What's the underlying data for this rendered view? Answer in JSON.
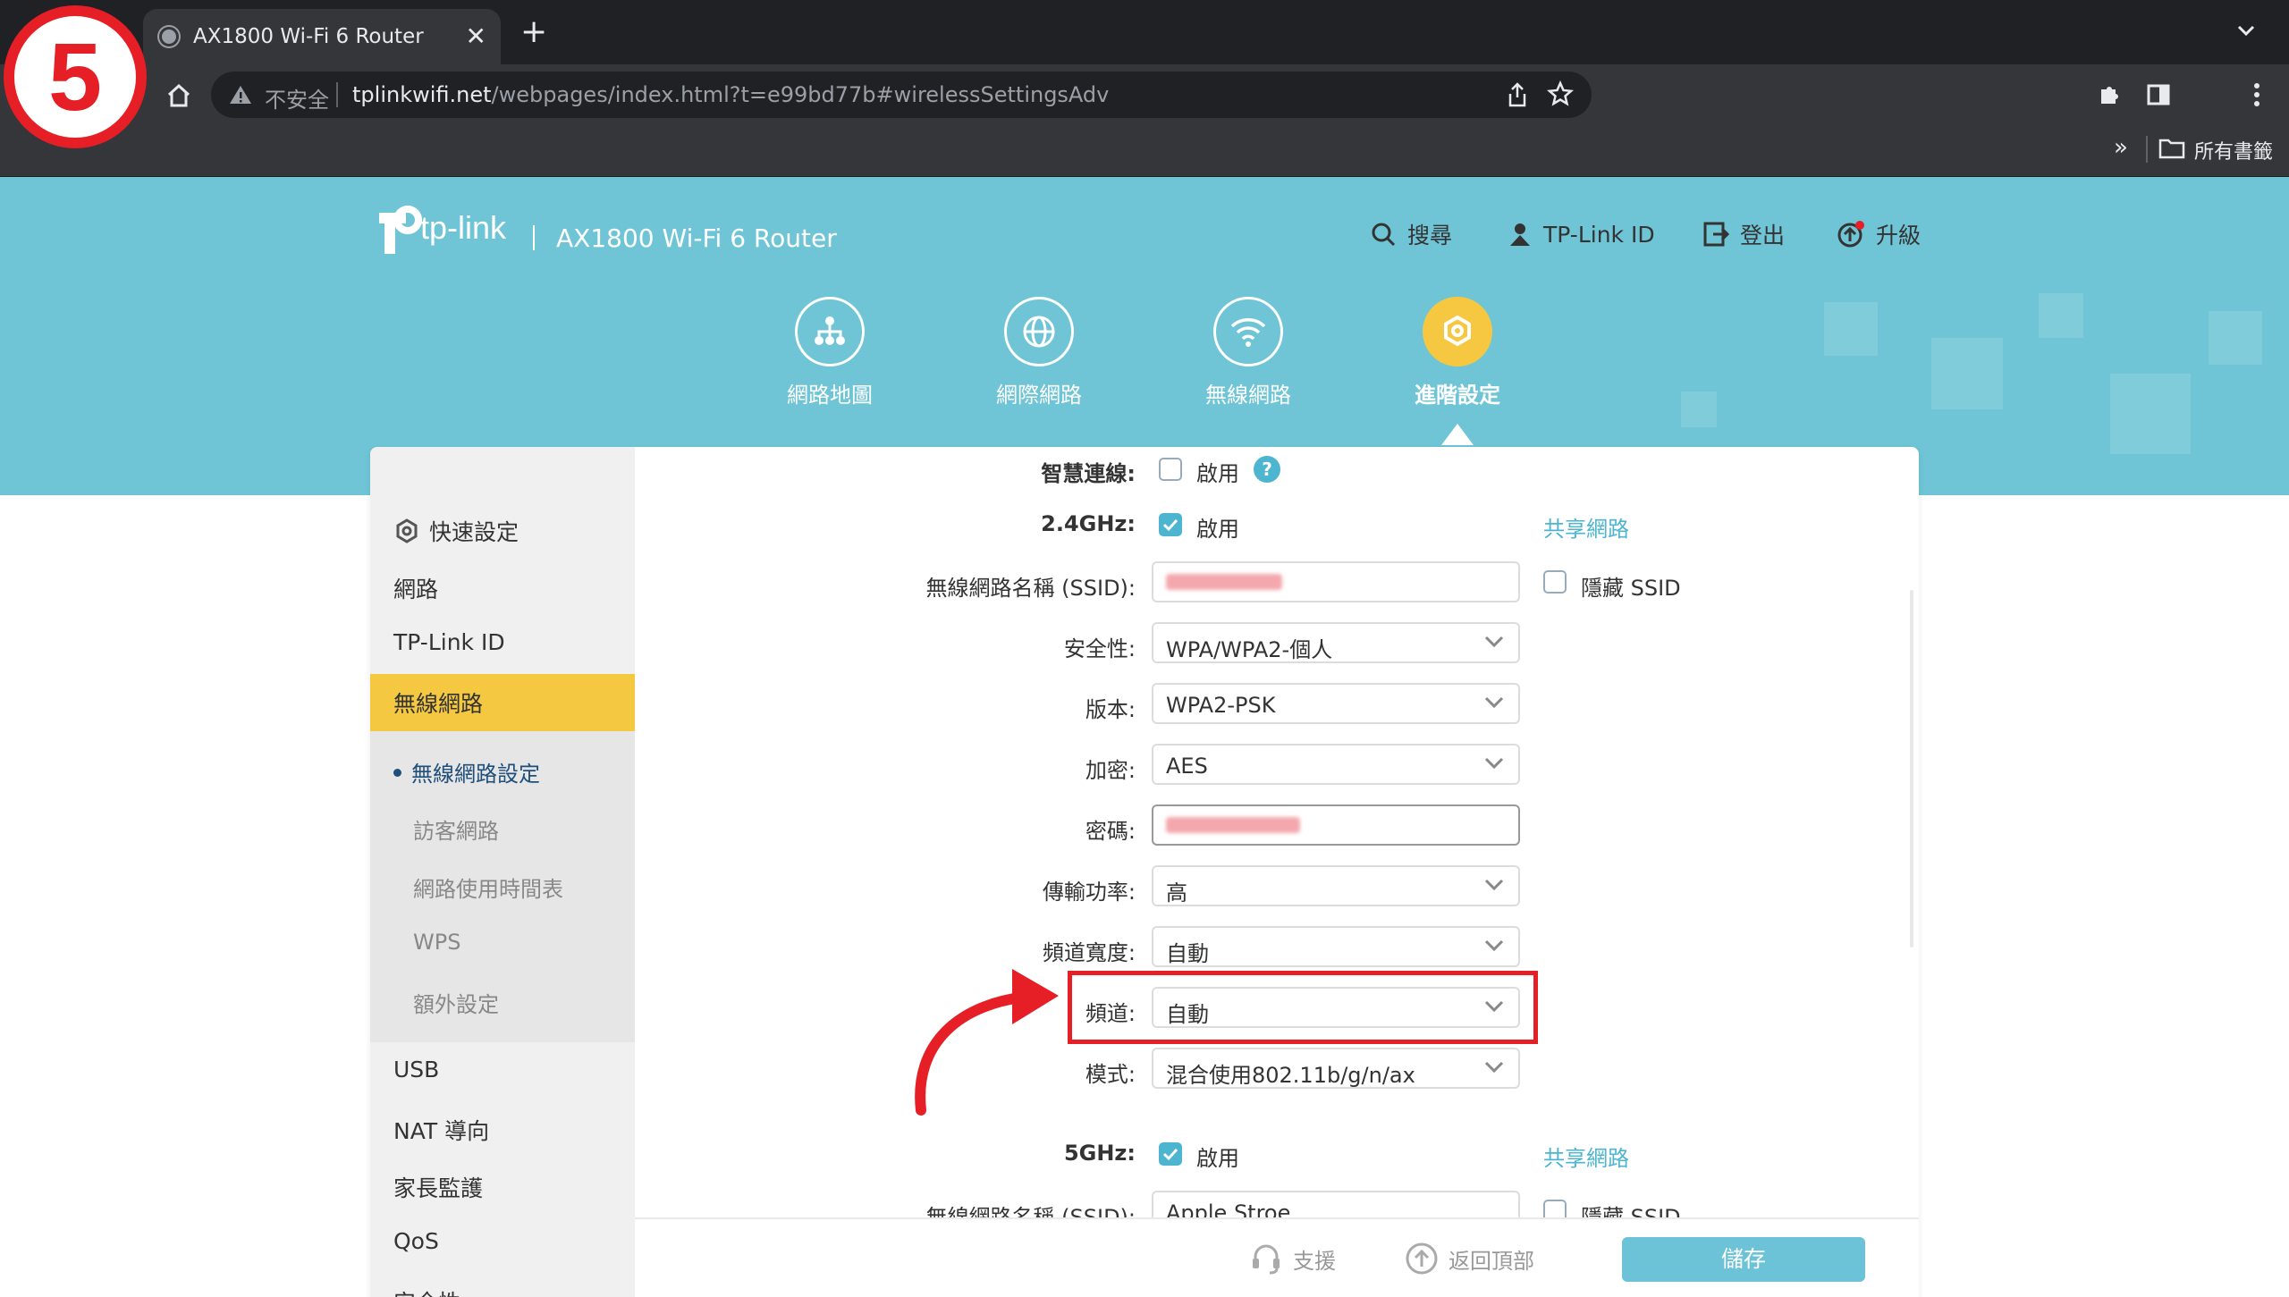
{
  "browser": {
    "tab_title": "AX1800 Wi-Fi 6 Router",
    "tab_close": "✕",
    "new_tab": "+",
    "insecure_label": "不安全",
    "url_host": "tplinkwifi.net",
    "url_path": "/webpages/index.html?t=e99bd77b#wirelessSettingsAdv",
    "bookmarks_overflow": "»",
    "bookmarks_folder": "所有書籤"
  },
  "overlay": {
    "step_number": "5"
  },
  "header": {
    "brand": "tp-link",
    "product": "AX1800 Wi-Fi 6 Router",
    "links": {
      "search": "搜尋",
      "tplink_id": "TP-Link ID",
      "logout": "登出",
      "upgrade": "升級"
    }
  },
  "nav": {
    "items": [
      {
        "label": "網路地圖",
        "icon": "network-map-icon"
      },
      {
        "label": "網際網路",
        "icon": "globe-icon"
      },
      {
        "label": "無線網路",
        "icon": "wifi-icon"
      },
      {
        "label": "進階設定",
        "icon": "gear-icon",
        "active": true
      }
    ]
  },
  "sidebar": {
    "items": [
      "快速設定",
      "網路",
      "TP-Link ID",
      "無線網路",
      "USB",
      "NAT 導向",
      "家長監護",
      "QoS",
      "安全性"
    ],
    "sub_items": [
      "無線網路設定",
      "訪客網路",
      "網路使用時間表",
      "WPS",
      "額外設定"
    ],
    "active_item": "無線網路",
    "current_sub": "無線網路設定"
  },
  "form": {
    "smart_connect_label": "智慧連線:",
    "enable_label": "啟用",
    "help_mark": "?",
    "band24_label": "2.4GHz:",
    "band5_label": "5GHz:",
    "share_network": "共享網路",
    "ssid_label": "無線網路名稱 (SSID):",
    "hide_ssid": "隱藏 SSID",
    "security_label": "安全性:",
    "security_value": "WPA/WPA2-個人",
    "version_label": "版本:",
    "version_value": "WPA2-PSK",
    "encryption_label": "加密:",
    "encryption_value": "AES",
    "password_label": "密碼:",
    "tx_power_label": "傳輸功率:",
    "tx_power_value": "高",
    "channel_width_label": "頻道寬度:",
    "channel_width_value": "自動",
    "channel_label": "頻道:",
    "channel_value": "自動",
    "mode_label": "模式:",
    "mode_value": "混合使用802.11b/g/n/ax",
    "ssid5_value": "Apple Stroe"
  },
  "footer": {
    "support": "支援",
    "back_to_top": "返回頂部",
    "save": "儲存"
  },
  "colors": {
    "banner": "#6fc5d6",
    "accent": "#4db5d0",
    "active_yellow": "#f5c842",
    "highlight_red": "#e61e25"
  }
}
